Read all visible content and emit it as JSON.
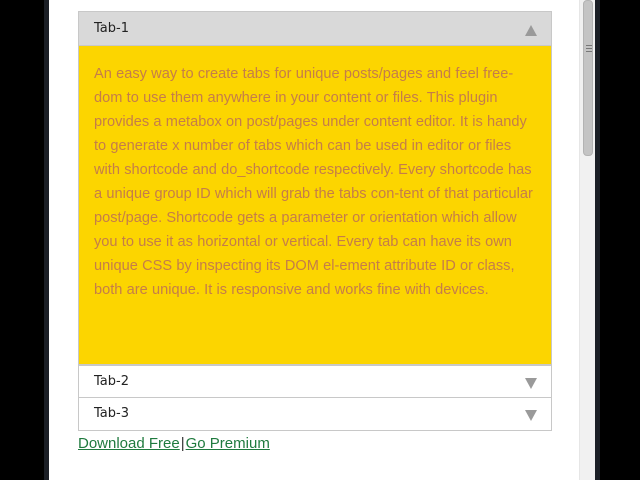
{
  "accordion": {
    "tabs": [
      {
        "label": "Tab-1",
        "expanded": true,
        "content": "An easy way to create tabs for unique posts/pages and feel free-dom to use them anywhere in your content or files. This plugin provides a metabox on post/pages under content editor. It is handy to generate x number of tabs which can be used in editor or files with shortcode and do_shortcode respectively. Every shortcode has a unique group ID which will grab the tabs con-tent of that particular post/page. Shortcode gets a parameter or orientation which allow you to use it as horizontal or vertical. Every tab can have its own unique CSS by inspecting its DOM el-ement attribute ID or class, both are unique. It is responsive and works fine with devices."
      },
      {
        "label": "Tab-2",
        "expanded": false
      },
      {
        "label": "Tab-3",
        "expanded": false
      }
    ],
    "colors": {
      "active_header_bg": "#d9d9d9",
      "content_bg": "#fcd500",
      "content_text": "#c57d49",
      "arrow": "#9a9a9a"
    },
    "icons": {
      "expanded": "triangle-up-icon",
      "collapsed": "triangle-down-icon"
    }
  },
  "footer": {
    "download_label": "Download Free",
    "separator": "|",
    "premium_label": "Go Premium",
    "link_color": "#1f7a3e"
  }
}
